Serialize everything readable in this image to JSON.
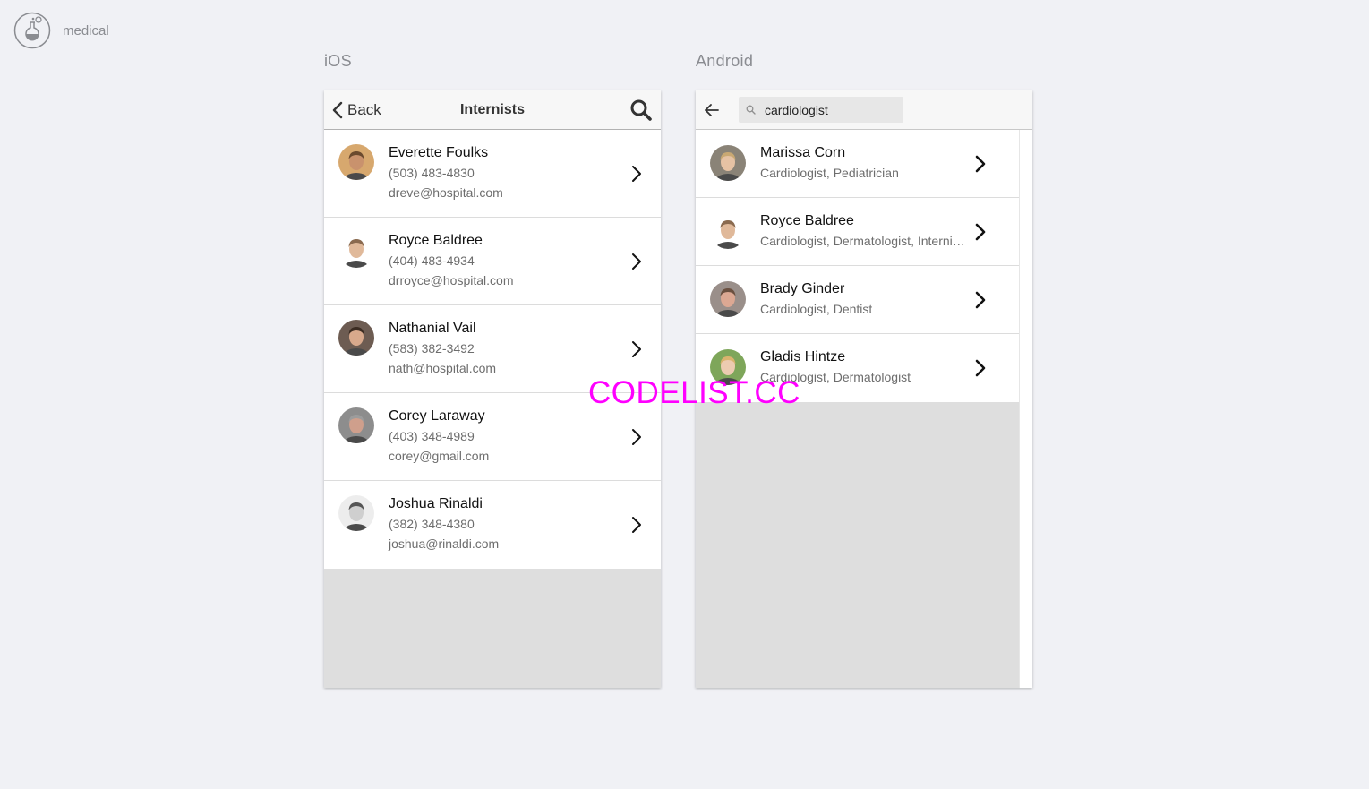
{
  "brand": "medical",
  "platforms": {
    "ios": "iOS",
    "android": "Android"
  },
  "ios": {
    "back_label": "Back",
    "title": "Internists",
    "contacts": [
      {
        "name": "Everette Foulks",
        "phone": "(503) 483-4830",
        "email": "dreve@hospital.com",
        "skin": "#c9926d",
        "hair": "#6b4a2e",
        "bg": "#d7a86e"
      },
      {
        "name": "Royce Baldree",
        "phone": "(404) 483-4934",
        "email": "drroyce@hospital.com",
        "skin": "#e0b99a",
        "hair": "#8a6a4f",
        "bg": "#ffffff"
      },
      {
        "name": "Nathanial Vail",
        "phone": "(583) 382-3492",
        "email": "nath@hospital.com",
        "skin": "#d8a98c",
        "hair": "#3b2c22",
        "bg": "#6d5c52"
      },
      {
        "name": "Corey Laraway",
        "phone": "(403) 348-4989",
        "email": "corey@gmail.com",
        "skin": "#cf9f8c",
        "hair": "#9c9c9c",
        "bg": "#8d8d8d"
      },
      {
        "name": "Joshua Rinaldi",
        "phone": "(382) 348-4380",
        "email": "joshua@rinaldi.com",
        "skin": "#cfcfcf",
        "hair": "#555555",
        "bg": "#ededed"
      }
    ]
  },
  "android": {
    "search_value": "cardiologist",
    "results": [
      {
        "name": "Marissa Corn",
        "specialties": "Cardiologist, Pediatrician",
        "skin": "#e6c2a4",
        "hair": "#c9a873",
        "bg": "#8a8377"
      },
      {
        "name": "Royce Baldree",
        "specialties": "Cardiologist, Dermatologist, Interni…",
        "skin": "#e0b99a",
        "hair": "#8a6a4f",
        "bg": "#ffffff"
      },
      {
        "name": "Brady Ginder",
        "specialties": "Cardiologist, Dentist",
        "skin": "#dca893",
        "hair": "#6b5040",
        "bg": "#9a8f8a"
      },
      {
        "name": "Gladis Hintze",
        "specialties": "Cardiologist, Dermatologist",
        "skin": "#eccbb1",
        "hair": "#d9b36e",
        "bg": "#7ea65a"
      }
    ]
  },
  "watermark": "CODELIST.CC"
}
